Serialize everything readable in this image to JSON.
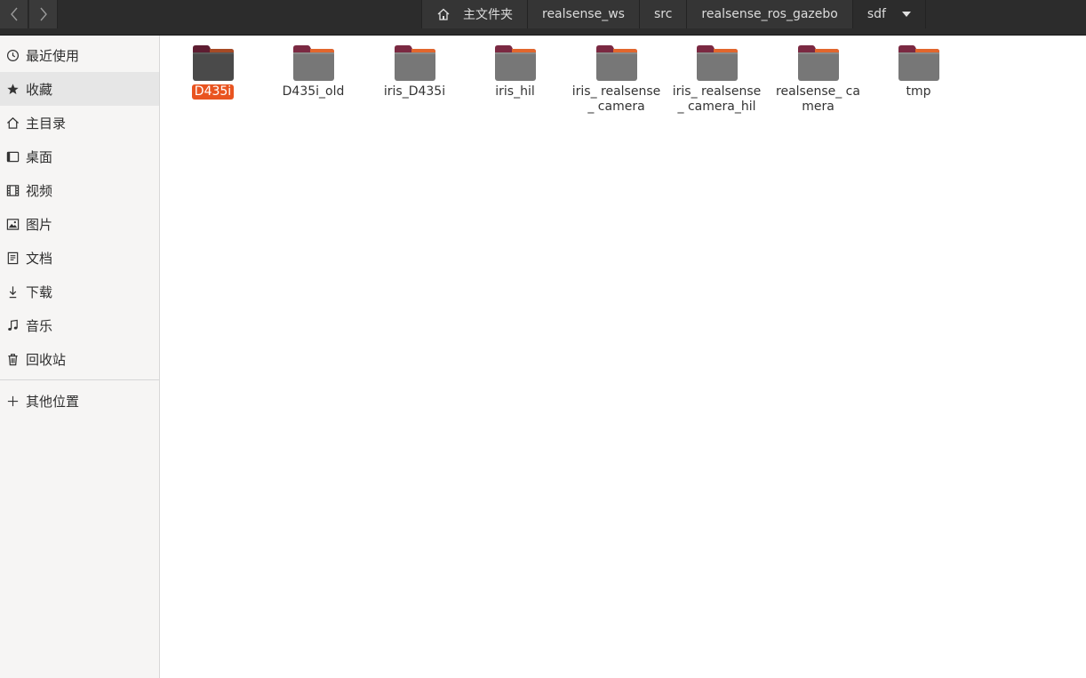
{
  "header": {
    "back_label": "‹",
    "forward_label": "›",
    "breadcrumbs": [
      "主文件夹",
      "realsense_ws",
      "src",
      "realsense_ros_gazebo",
      "sdf"
    ]
  },
  "sidebar": {
    "items": [
      {
        "label": "最近使用",
        "icon": "clock-icon"
      },
      {
        "label": "收藏",
        "icon": "star-icon"
      },
      {
        "label": "主目录",
        "icon": "home-icon"
      },
      {
        "label": "桌面",
        "icon": "desktop-icon"
      },
      {
        "label": "视频",
        "icon": "video-icon"
      },
      {
        "label": "图片",
        "icon": "image-icon"
      },
      {
        "label": "文档",
        "icon": "document-icon"
      },
      {
        "label": "下载",
        "icon": "download-icon"
      },
      {
        "label": "音乐",
        "icon": "music-icon"
      },
      {
        "label": "回收站",
        "icon": "trash-icon"
      }
    ],
    "other": {
      "label": "其他位置",
      "icon": "plus-icon"
    }
  },
  "files": [
    {
      "name": "D435i",
      "selected": true
    },
    {
      "name": "D435i_old"
    },
    {
      "name": "iris_D435i"
    },
    {
      "name": "iris_hil"
    },
    {
      "name": "iris_ realsense_ camera"
    },
    {
      "name": "iris_ realsense_ camera_hil"
    },
    {
      "name": "realsense_ camera"
    },
    {
      "name": "tmp"
    }
  ],
  "colors": {
    "accent": "#e95420",
    "folder_tab": "#7a2a3a",
    "folder_body": "#7a7a7a"
  }
}
